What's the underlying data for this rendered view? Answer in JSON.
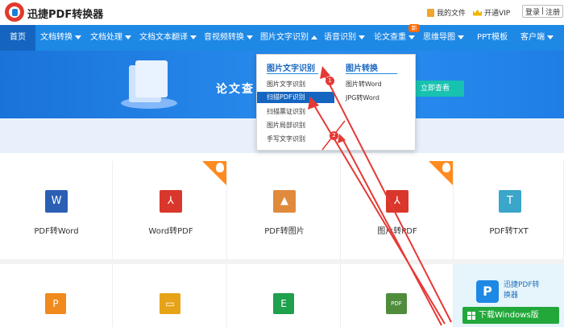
{
  "app": {
    "name": "迅捷PDF转换器"
  },
  "header": {
    "my_files": "我的文件",
    "vip": "开通VIP",
    "login": "登录",
    "separator": "|",
    "register": "注册"
  },
  "nav": {
    "items": [
      {
        "label": "首页"
      },
      {
        "label": "文档转换"
      },
      {
        "label": "文档处理"
      },
      {
        "label": "文档文本翻译"
      },
      {
        "label": "音视频转换"
      },
      {
        "label": "图片文字识别"
      },
      {
        "label": "语音识别"
      },
      {
        "label": "论文查重"
      },
      {
        "label": "思维导图"
      },
      {
        "label": "PPT模板"
      },
      {
        "label": "客户端"
      }
    ],
    "new_badge": "新"
  },
  "banner": {
    "title": "论文查",
    "button": "立即查看"
  },
  "dropdown": {
    "col1": {
      "title": "图片文字识别",
      "items": [
        "图片文字识别",
        "扫描PDF识别",
        "扫描票证识别",
        "图片局部识别",
        "手写文字识别"
      ]
    },
    "col2": {
      "title": "图片转换",
      "items": [
        "图片转Word",
        "JPG转Word"
      ]
    }
  },
  "tools_row1": [
    {
      "label": "PDF转Word",
      "icon": "W",
      "color": "#2b5fb3",
      "hot": false
    },
    {
      "label": "Word转PDF",
      "icon": "⅄",
      "color": "#d9372b",
      "hot": true
    },
    {
      "label": "PDF转图片",
      "icon": "▲",
      "color": "#e08a3c",
      "hot": false
    },
    {
      "label": "图片转PDF",
      "icon": "⅄",
      "color": "#d9372b",
      "hot": true
    },
    {
      "label": "PDF转TXT",
      "icon": "T",
      "color": "#3aa6c9",
      "hot": false
    }
  ],
  "tools_row2": [
    {
      "icon": "P",
      "color": "#f08a1c"
    },
    {
      "icon": "▭",
      "color": "#e6a317"
    },
    {
      "icon": "E",
      "color": "#1ea04c"
    },
    {
      "icon": "PDF",
      "color": "#4f8d3d"
    }
  ],
  "promo": {
    "logo": "P",
    "line1": "迅捷PDF转",
    "line2": "换器",
    "download": "下载Windows版"
  },
  "annotations": {
    "marker1": "1",
    "marker2": "2"
  }
}
